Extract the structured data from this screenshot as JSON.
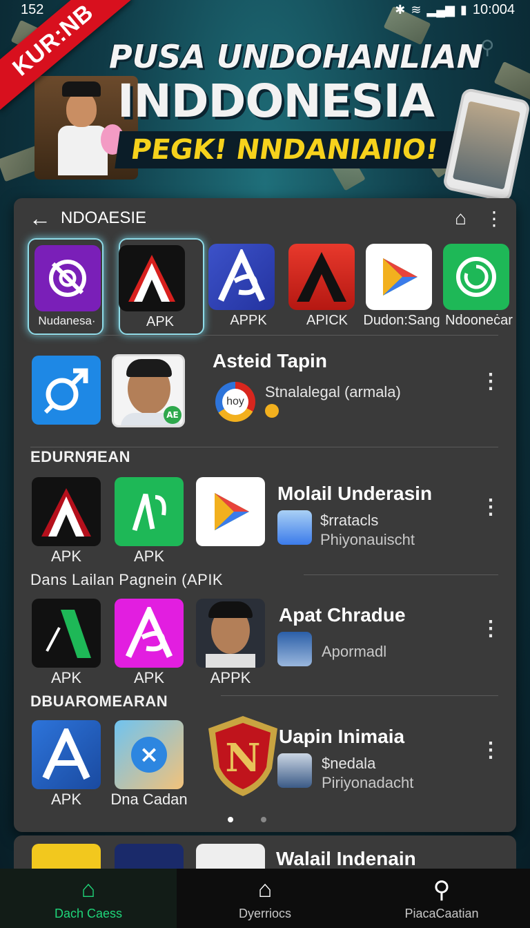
{
  "status_bar": {
    "time_left": "152",
    "time_right": "10:004"
  },
  "banner": {
    "ribbon": "KUR:NB",
    "headline_line1": "PUSA UNDOHANLIAN",
    "headline_line2": "INDDONESIA",
    "subheadline": "PEGK! NNDANIAIIO!"
  },
  "panel": {
    "title": "NDOAESIE",
    "apps": [
      {
        "label": "Nudanesa·",
        "icon": "target-icon",
        "color": "#7a1fb8",
        "selected": true
      },
      {
        "label": "APK",
        "icon": "letter-a-icon",
        "color": "#111111",
        "selected": true
      },
      {
        "label": "APPK",
        "icon": "letter-a-icon",
        "color": "#2d3fb3",
        "selected": false
      },
      {
        "label": "APICK",
        "icon": "letter-a-icon",
        "color": "#d8261e",
        "selected": false
      },
      {
        "label": "Dudon:Sang",
        "icon": "play-store-icon",
        "color": "#ffffff",
        "selected": false
      },
      {
        "label": "Ndooneċar",
        "icon": "whatsapp-icon",
        "color": "#1eb857",
        "selected": false
      }
    ],
    "featured": {
      "title": "Asteid Tapin",
      "subtitle": "Stnalalegal (armala)",
      "logo_text": "hoy"
    },
    "section1": "EDURNЯEAN",
    "item1": {
      "title": "Molail Underasin",
      "sub1": "$rratacls",
      "sub2": "Phiyonauischt",
      "label_a": "APK",
      "label_b": "APK"
    },
    "section2": "Dans Lailan Pagnein (APIK",
    "item2": {
      "title": "Apat Chradue",
      "sub2": "Apormadl",
      "label_a": "APK",
      "label_b": "APK",
      "label_c": "APPK"
    },
    "section3": "DBUAROMEARAN",
    "item3": {
      "title": "Uapin Inimaia",
      "sub1": "$nedala",
      "sub2": "Piriyonadacht",
      "label_a": "APK",
      "label_b": "Dna Cadan"
    },
    "peek_title": "Walail Indenain"
  },
  "nav": {
    "items": [
      {
        "label": "Dach Caess",
        "icon": "home-icon",
        "active": true
      },
      {
        "label": "Dyerriocs",
        "icon": "home-outline-icon",
        "active": false
      },
      {
        "label": "PiacaCaatian",
        "icon": "search-icon",
        "active": false
      }
    ]
  }
}
